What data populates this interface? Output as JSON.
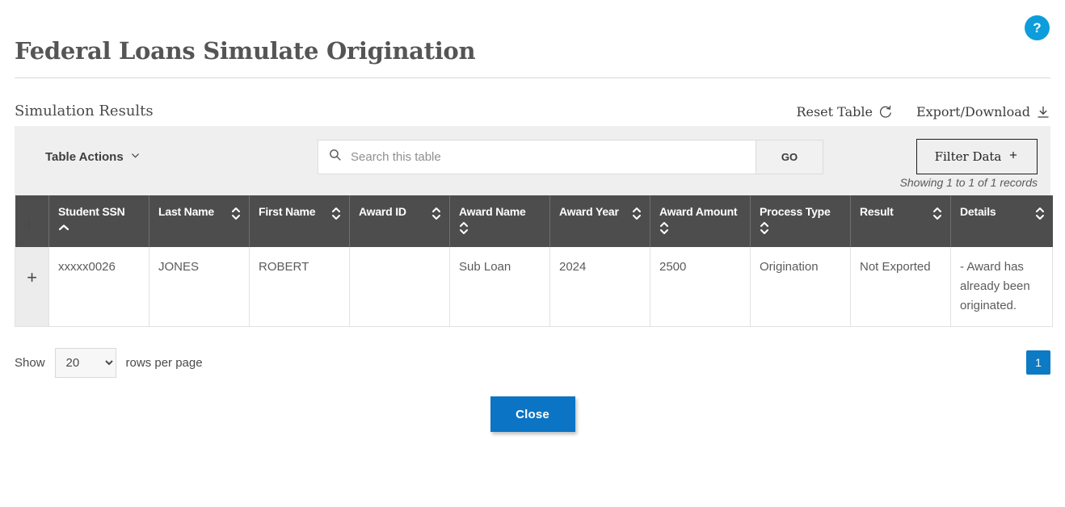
{
  "help": {
    "label": "?",
    "icon": "question-mark-icon"
  },
  "page": {
    "title": "Federal Loans Simulate Origination"
  },
  "region": {
    "title": "Simulation Results",
    "reset_table_label": "Reset Table",
    "reset_table_icon": "refresh-ccw-icon",
    "export_label": "Export/Download",
    "export_icon": "download-icon"
  },
  "toolbar": {
    "table_actions_label": "Table Actions",
    "table_actions_icon": "chevron-down-icon",
    "search_icon": "search-icon",
    "search_value": "",
    "search_placeholder": "Search this table",
    "go_label": "GO",
    "filter_label": "Filter Data",
    "filter_icon": "plus-icon",
    "records_note": "Showing 1 to 1 of 1 records"
  },
  "table": {
    "expander_label": "+",
    "columns": [
      {
        "label": "Student SSN",
        "sort": "asc"
      },
      {
        "label": "Last Name",
        "sort": "none"
      },
      {
        "label": "First Name",
        "sort": "none"
      },
      {
        "label": "Award ID",
        "sort": "none"
      },
      {
        "label": "Award Name",
        "sort": "none"
      },
      {
        "label": "Award Year",
        "sort": "none"
      },
      {
        "label": "Award Amount",
        "sort": "none"
      },
      {
        "label": "Process Type",
        "sort": "none"
      },
      {
        "label": "Result",
        "sort": "none"
      },
      {
        "label": "Details",
        "sort": "none"
      }
    ],
    "rows": [
      {
        "expander": "+",
        "student_ssn": "xxxxx0026",
        "last_name": "JONES",
        "first_name": "ROBERT",
        "award_id": "",
        "award_name": "Sub Loan",
        "award_year": "2024",
        "award_amount": "2500",
        "process_type": "Origination",
        "result": "Not Exported",
        "details": " - Award has already been originated."
      }
    ]
  },
  "footer": {
    "show_label": "Show",
    "rows_value": "20",
    "rows_options": [
      "20"
    ],
    "rows_per_page_label": "rows per page",
    "page_number": "1",
    "close_label": "Close"
  },
  "colors": {
    "help_blue": "#0d9ddb",
    "accent_blue": "#0c74c4",
    "page_badge_blue": "#0d7ac4",
    "header_gray": "#4d4d4d",
    "toolbar_gray": "#efefef"
  }
}
